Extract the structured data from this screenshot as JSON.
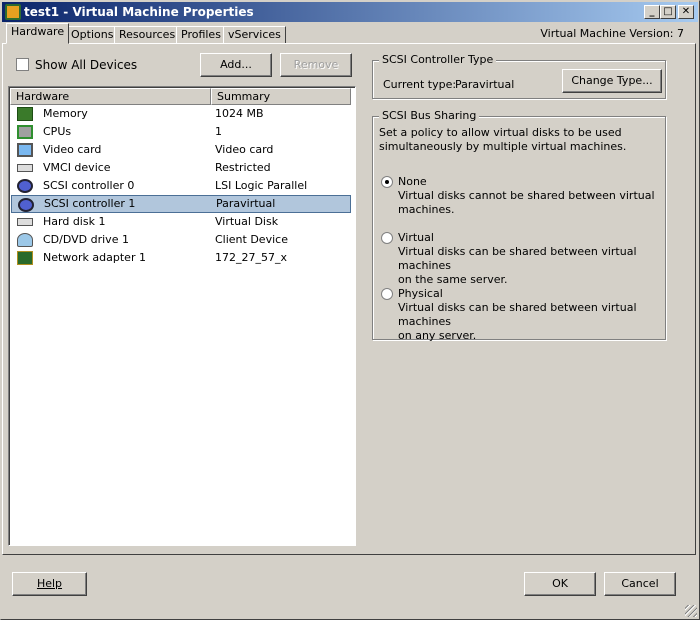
{
  "window": {
    "title": "test1 - Virtual Machine Properties",
    "version_label": "Virtual Machine Version: 7"
  },
  "tabs": [
    {
      "label": "Hardware"
    },
    {
      "label": "Options"
    },
    {
      "label": "Resources"
    },
    {
      "label": "Profiles"
    },
    {
      "label": "vServices"
    }
  ],
  "hardware": {
    "show_all_label": "Show All Devices",
    "add_label": "Add...",
    "remove_label": "Remove",
    "columns": [
      "Hardware",
      "Summary"
    ],
    "rows": [
      {
        "name": "Memory",
        "summary": "1024 MB",
        "icon": "memory-icon"
      },
      {
        "name": "CPUs",
        "summary": "1",
        "icon": "cpu-icon"
      },
      {
        "name": "Video card",
        "summary": "Video card",
        "icon": "monitor-icon"
      },
      {
        "name": "VMCI device",
        "summary": "Restricted",
        "icon": "device-icon"
      },
      {
        "name": "SCSI controller 0",
        "summary": "LSI Logic Parallel",
        "icon": "scsi-icon"
      },
      {
        "name": "SCSI controller 1",
        "summary": "Paravirtual",
        "icon": "scsi-icon"
      },
      {
        "name": "Hard disk 1",
        "summary": "Virtual Disk",
        "icon": "disk-icon"
      },
      {
        "name": "CD/DVD drive 1",
        "summary": "Client Device",
        "icon": "cdrom-icon"
      },
      {
        "name": "Network adapter 1",
        "summary": "172_27_57_x",
        "icon": "nic-icon"
      }
    ],
    "selected": 5
  },
  "controller_type": {
    "legend": "SCSI Controller Type",
    "current_label": "Current type:",
    "current_value": "Paravirtual",
    "change_label": "Change Type..."
  },
  "bus_sharing": {
    "legend": "SCSI Bus Sharing",
    "description_1": "Set a policy to allow virtual disks to be used",
    "description_2": "simultaneously by multiple virtual machines.",
    "options": [
      {
        "label": "None",
        "desc_1": "Virtual disks cannot be shared between virtual",
        "desc_2": "machines.",
        "checked": true
      },
      {
        "label": "Virtual",
        "desc_1": "Virtual disks can be shared between virtual machines",
        "desc_2": "on the same server.",
        "checked": false
      },
      {
        "label": "Physical",
        "desc_1": "Virtual disks can be shared between virtual machines",
        "desc_2": "on any server.",
        "checked": false
      }
    ]
  },
  "footer": {
    "help": "Help",
    "ok": "OK",
    "cancel": "Cancel"
  }
}
